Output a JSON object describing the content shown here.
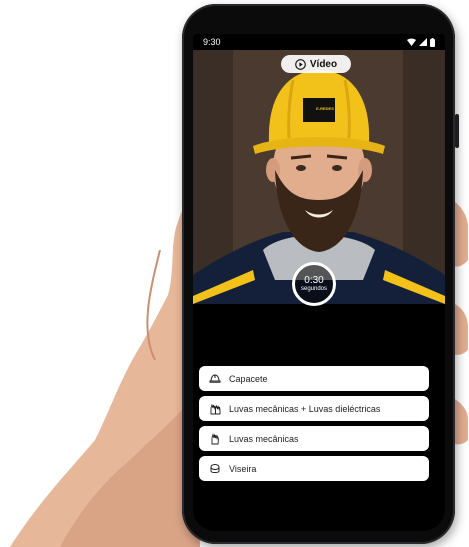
{
  "status_bar": {
    "time": "9:30"
  },
  "camera_view": {
    "video_button_label": "Vídeo",
    "helmet_logo_text": "E-REDES"
  },
  "timer": {
    "time": "0:30",
    "unit": "segundos"
  },
  "equipment_list": [
    {
      "label": "Capacete",
      "icon": "hard-hat-icon"
    },
    {
      "label": "Luvas mecânicas + Luvas dieléctricas",
      "icon": "gloves-icon"
    },
    {
      "label": "Luvas mecânicas",
      "icon": "glove-icon"
    },
    {
      "label": "Viseira",
      "icon": "visor-icon"
    }
  ],
  "colors": {
    "helmet": "#f2c21b",
    "jacket_stripe": "#f2c21b",
    "phone_body": "#0b0b0c",
    "list_item_bg": "#ffffff"
  }
}
